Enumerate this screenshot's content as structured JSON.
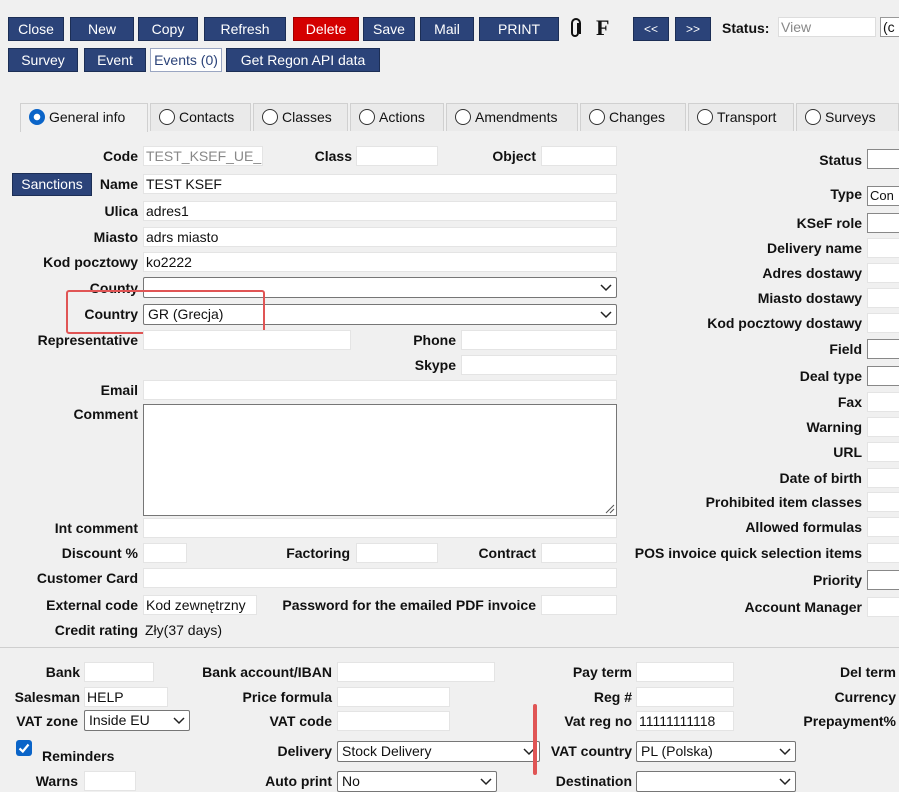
{
  "toolbar": {
    "close": "Close",
    "new": "New",
    "copy": "Copy",
    "refresh": "Refresh",
    "delete": "Delete",
    "save": "Save",
    "mail": "Mail",
    "print": "PRINT",
    "f": "F",
    "prev": "<<",
    "next": ">>",
    "status_label": "Status:",
    "status_value": "View",
    "status_extra": "(c",
    "survey": "Survey",
    "event": "Event",
    "events_count": "Events (0)",
    "regon": "Get Regon API data"
  },
  "tabs": [
    {
      "label": "General info",
      "active": true
    },
    {
      "label": "Contacts",
      "active": false
    },
    {
      "label": "Classes",
      "active": false
    },
    {
      "label": "Actions",
      "active": false
    },
    {
      "label": "Amendments",
      "active": false
    },
    {
      "label": "Changes",
      "active": false
    },
    {
      "label": "Transport",
      "active": false
    },
    {
      "label": "Surveys",
      "active": false
    }
  ],
  "general": {
    "code_label": "Code",
    "code_value": "TEST_KSEF_UE_",
    "class_label": "Class",
    "object_label": "Object",
    "sanctions": "Sanctions",
    "name_label": "Name",
    "name_value": "TEST KSEF",
    "ulica_label": "Ulica",
    "ulica_value": "adres1",
    "miasto_label": "Miasto",
    "miasto_value": "adrs miasto",
    "kod_label": "Kod pocztowy",
    "kod_value": "ko2222",
    "county_label": "County",
    "county_value": "",
    "country_label": "Country",
    "country_value": "GR (Grecja)",
    "representative_label": "Representative",
    "phone_label": "Phone",
    "skype_label": "Skype",
    "email_label": "Email",
    "comment_label": "Comment",
    "int_comment_label": "Int comment",
    "discount_label": "Discount %",
    "factoring_label": "Factoring",
    "contract_label": "Contract",
    "customer_card_label": "Customer Card",
    "external_code_label": "External code",
    "external_code_value": "Kod zewnętrzny",
    "password_label": "Password for the emailed PDF invoice",
    "credit_label": "Credit rating",
    "credit_value": "Zły(37 days)"
  },
  "right": {
    "status": "Status",
    "type": "Type",
    "type_value": "Con",
    "ksef_role": "KSeF role",
    "delivery_name": "Delivery name",
    "adres_dostawy": "Adres dostawy",
    "miasto_dostawy": "Miasto dostawy",
    "kod_dostawy": "Kod pocztowy dostawy",
    "field": "Field",
    "deal_type": "Deal type",
    "fax": "Fax",
    "warning": "Warning",
    "url": "URL",
    "dob": "Date of birth",
    "prohibited": "Prohibited item classes",
    "allowed": "Allowed formulas",
    "pos": "POS invoice quick selection items",
    "priority": "Priority",
    "account_manager": "Account Manager"
  },
  "bottom": {
    "bank": "Bank",
    "bank_account": "Bank account/IBAN",
    "pay_term": "Pay term",
    "del_term": "Del term",
    "salesman": "Salesman",
    "salesman_value": "HELP",
    "price_formula": "Price formula",
    "reg": "Reg #",
    "currency": "Currency",
    "vat_zone": "VAT zone",
    "vat_zone_value": "Inside EU",
    "vat_code": "VAT code",
    "vat_reg_no": "Vat reg no",
    "vat_reg_value": "11111111118",
    "prepayment": "Prepayment%",
    "reminders": "Reminders",
    "delivery": "Delivery",
    "delivery_value": "Stock Delivery",
    "vat_country": "VAT country",
    "vat_country_value": "PL (Polska)",
    "warns": "Warns",
    "auto_print": "Auto print",
    "auto_print_value": "No",
    "destination": "Destination"
  }
}
